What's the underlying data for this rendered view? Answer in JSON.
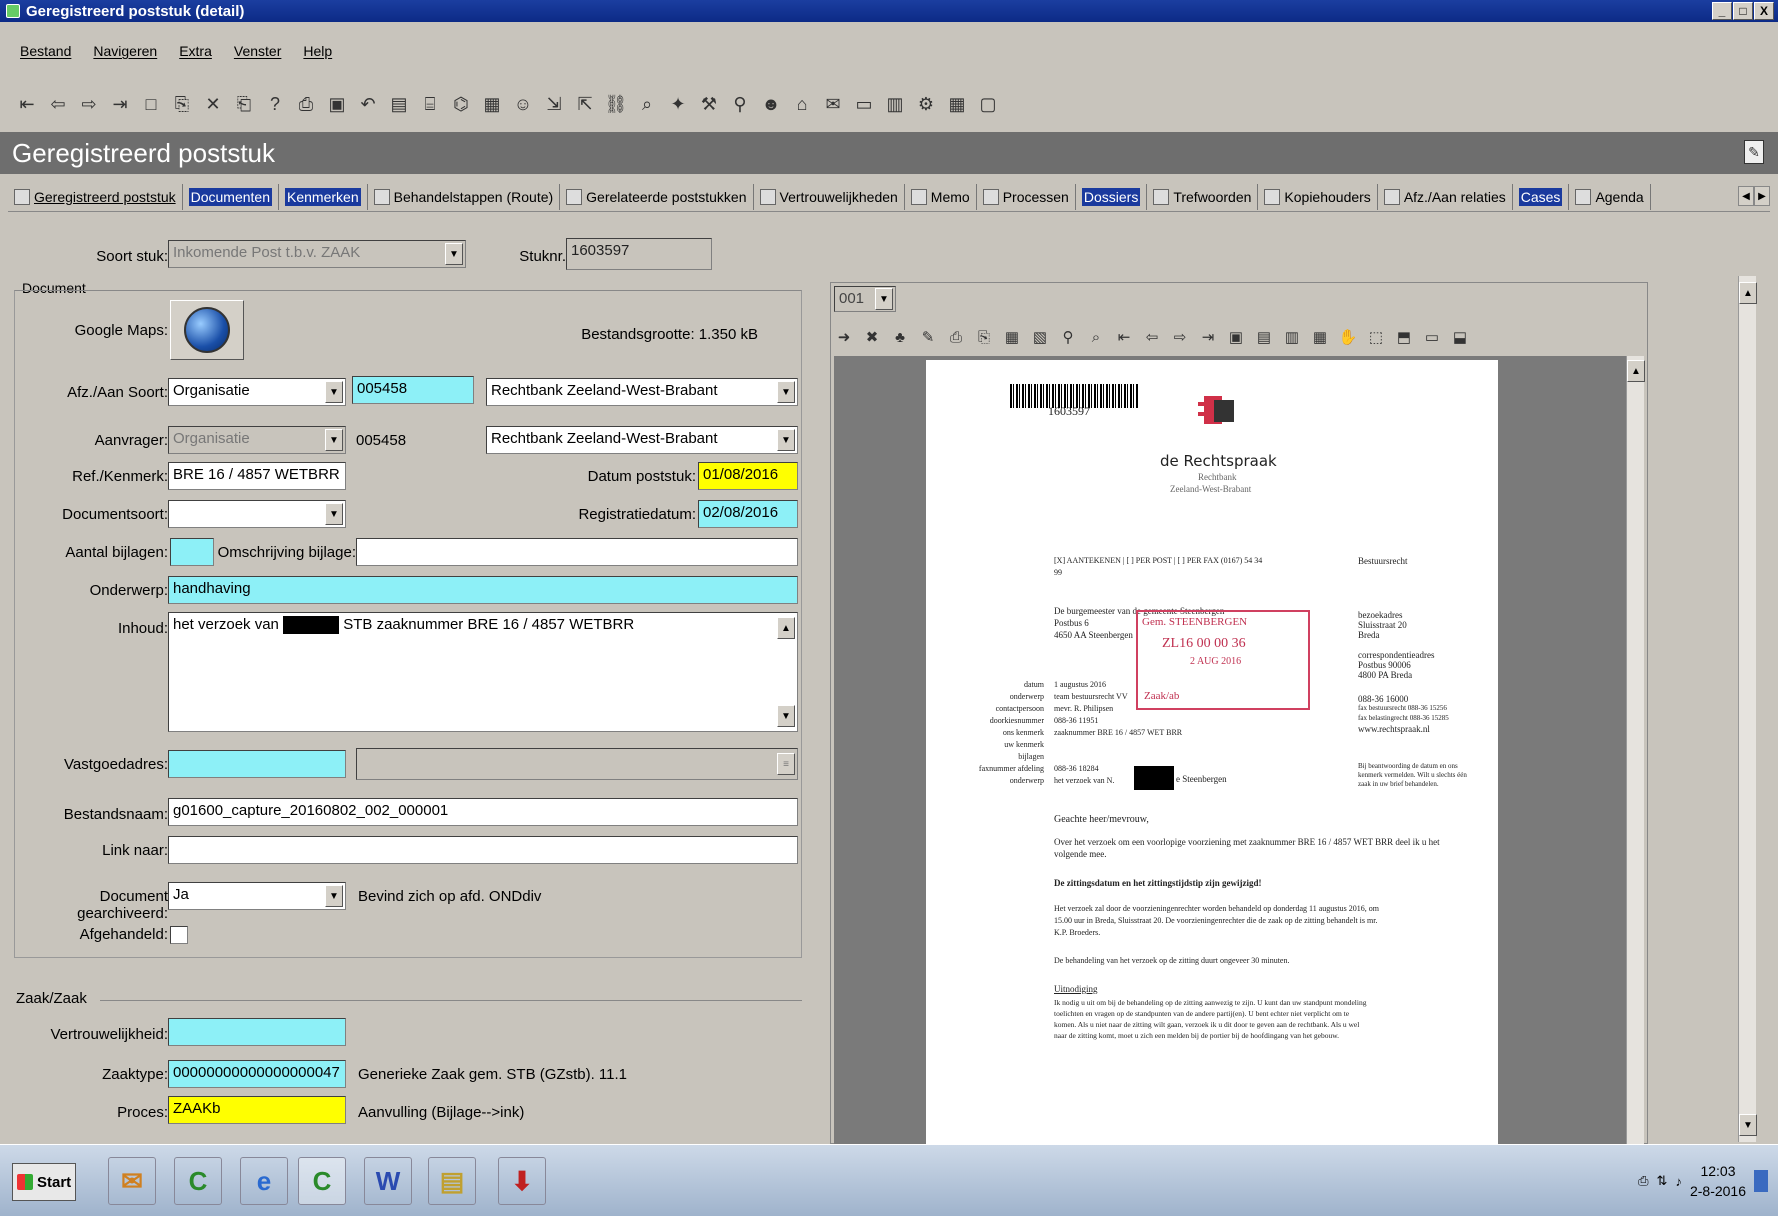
{
  "window": {
    "title": "Geregistreerd poststuk (detail)",
    "buttons": [
      "_",
      "□",
      "X"
    ]
  },
  "menu": [
    "Bestand",
    "Navigeren",
    "Extra",
    "Venster",
    "Help"
  ],
  "toolbar_icons": [
    "first-record-icon",
    "previous-icon",
    "next-icon",
    "last-record-icon",
    "new-icon",
    "copy-icon",
    "delete-icon",
    "paste-icon",
    "help-icon",
    "print-icon",
    "save-icon",
    "undo-icon",
    "form-icon",
    "scan-icon",
    "attach-icon",
    "report-icon",
    "user-icon",
    "import-icon",
    "export-icon",
    "link-icon",
    "search-icon",
    "puzzle-icon",
    "tools-icon",
    "find-icon",
    "people-icon",
    "home-icon",
    "mail-icon",
    "clipboard-icon",
    "archive-icon",
    "settings-icon",
    "grid-icon",
    "page-icon"
  ],
  "header": {
    "title": "Geregistreerd poststuk"
  },
  "tabs": [
    {
      "label": "Geregistreerd poststuk",
      "hl": false
    },
    {
      "label": "Documenten",
      "hl": true
    },
    {
      "label": "Kenmerken",
      "hl": true
    },
    {
      "label": "Behandelstappen (Route)",
      "hl": false
    },
    {
      "label": "Gerelateerde poststukken",
      "hl": false
    },
    {
      "label": "Vertrouwelijkheden",
      "hl": false
    },
    {
      "label": "Memo",
      "hl": false
    },
    {
      "label": "Processen",
      "hl": false
    },
    {
      "label": "Dossiers",
      "hl": true
    },
    {
      "label": "Trefwoorden",
      "hl": false
    },
    {
      "label": "Kopiehouders",
      "hl": false
    },
    {
      "label": "Afz./Aan relaties",
      "hl": false
    },
    {
      "label": "Cases",
      "hl": true
    },
    {
      "label": "Agenda",
      "hl": false
    }
  ],
  "form": {
    "soort_stuk_label": "Soort stuk:",
    "soort_stuk_value": "Inkomende Post t.b.v. ZAAK",
    "stuknr_label": "Stuknr.",
    "stuknr_value": "1603597",
    "document_group": "Document",
    "google_maps_label": "Google Maps:",
    "bestandsgrootte": "Bestandsgrootte: 1.350 kB",
    "afz_label": "Afz./Aan Soort:",
    "afz_soort": "Organisatie",
    "afz_code": "005458",
    "afz_naam": "Rechtbank Zeeland-West-Brabant",
    "aanvrager_label": "Aanvrager:",
    "aanvrager_soort": "Organisatie",
    "aanvrager_code": "005458",
    "aanvrager_naam": "Rechtbank Zeeland-West-Brabant",
    "ref_label": "Ref./Kenmerk:",
    "ref_value": "BRE 16 / 4857 WETBRR",
    "datum_poststuk_label": "Datum poststuk:",
    "datum_poststuk": "01/08/2016",
    "documentsoort_label": "Documentsoort:",
    "registratiedatum_label": "Registratiedatum:",
    "registratiedatum": "02/08/2016",
    "aantal_bijlagen_label": "Aantal bijlagen:",
    "omschrijving_bijlage_label": "Omschrijving bijlage:",
    "onderwerp_label": "Onderwerp:",
    "onderwerp": "handhaving",
    "inhoud_label": "Inhoud:",
    "inhoud_prefix": "het verzoek van",
    "inhoud_suffix": "STB zaaknummer BRE 16 / 4857 WETBRR",
    "vastgoedadres_label": "Vastgoedadres:",
    "bestandsnaam_label": "Bestandsnaam:",
    "bestandsnaam": "g01600_capture_20160802_002_000001",
    "link_naar_label": "Link naar:",
    "gearchiveerd_label": "Document gearchiveerd:",
    "gearchiveerd": "Ja",
    "bevind_zich": "Bevind zich op afd. ONDdiv",
    "afgehandeld_label": "Afgehandeld:",
    "zaak_group": "Zaak/Zaak",
    "vertrouwelijkheid_label": "Vertrouwelijkheid:",
    "zaaktype_label": "Zaaktype:",
    "zaaktype": "00000000000000000047",
    "zaaktype_omschrijving": "Generieke Zaak gem. STB (GZstb). 11.1",
    "proces_label": "Proces:",
    "proces": "ZAAKb",
    "proces_omschrijving": "Aanvulling (Bijlage-->ink)"
  },
  "viewer": {
    "page_select": "001",
    "doc": {
      "barcode_number": "1603597",
      "org": "de Rechtspraak",
      "org_sub1": "Rechtbank",
      "org_sub2": "Zeeland-West-Brabant",
      "send_line": "[X] AANTEKENEN | [ ] PER POST | [ ] PER FAX (0167) 54 34",
      "send_line2": "99",
      "bestuursrecht": "Bestuursrecht",
      "addr1": "De burgemeester van de gemeente Steenbergen",
      "addr2": "Postbus 6",
      "addr3": "4650 AA Steenbergen",
      "stamp1": "Gem. STEENBERGEN",
      "stamp2": "ZL16 00 00 36",
      "stamp3": "2 AUG 2016",
      "stamp4": "Zaak/ab",
      "bezoek1": "bezoekadres",
      "bezoek2": "Sluisstraat 20",
      "bezoek3": "Breda",
      "corr1": "correspondentieadres",
      "corr2": "Postbus 90006",
      "corr3": "4800 PA Breda",
      "tel1": "088-36 16000",
      "tel2": "fax bestuursrecht 088-36 15256",
      "tel3": "fax belastingrecht 088-36 15285",
      "web": "www.rechtspraak.nl",
      "meta_labels": [
        "datum",
        "onderwerp",
        "contactpersoon",
        "doorkiesnummer",
        "ons kenmerk",
        "uw kenmerk",
        "bijlagen",
        "faxnummer afdeling",
        "onderwerp"
      ],
      "meta_values": [
        "1 augustus 2016",
        "team bestuursrecht VV",
        "mevr. R. Philipsen",
        "088-36 11951",
        "zaaknummer BRE 16 / 4857 WET BRR",
        "",
        "",
        "088-36 18284",
        "het verzoek van N."
      ],
      "meta_suffix": "e Steenbergen",
      "side_note": "Bij beantwoording de datum en ons kenmerk vermelden. Wilt u slechts één zaak in uw brief behandelen.",
      "greeting": "Geachte heer/mevrouw,",
      "p1": "Over het verzoek om een voorlopige voorziening met zaaknummer BRE 16 / 4857 WET BRR deel ik u het volgende mee.",
      "h1": "De zittingsdatum en het zittingstijdstip zijn gewijzigd!",
      "p2a": "Het verzoek zal door de voorzieningenrechter worden behandeld op donderdag 11 augustus 2016, om",
      "p2b": "15.00 uur in Breda, Sluisstraat 20. De voorzieningenrechter die de zaak op de zitting behandelt is mr.",
      "p2c": "K.P. Broeders.",
      "p3": "De behandeling van het verzoek op de zitting duurt ongeveer 30 minuten.",
      "h2": "Uitnodiging",
      "p4a": "Ik nodig u uit om bij de behandeling op de zitting aanwezig te zijn. U kunt dan uw standpunt mondeling",
      "p4b": "toelichten en vragen op de standpunten van de andere partij(en). U bent echter niet verplicht om te",
      "p4c": "komen. Als u niet naar de zitting wilt gaan, verzoek ik u dit door te geven aan de rechtbank. Als u wel",
      "p4d": "naar de zitting komt, moet u zich een melden bij de portier bij de hoofdingang van het gebouw."
    }
  },
  "taskbar": {
    "start": "Start",
    "apps": [
      "outlook-icon",
      "corsa-icon",
      "internet-explorer-icon",
      "corsa-active-icon",
      "word-icon",
      "explorer-icon",
      "pdf-icon"
    ],
    "time": "12:03",
    "date": "2-8-2016"
  }
}
